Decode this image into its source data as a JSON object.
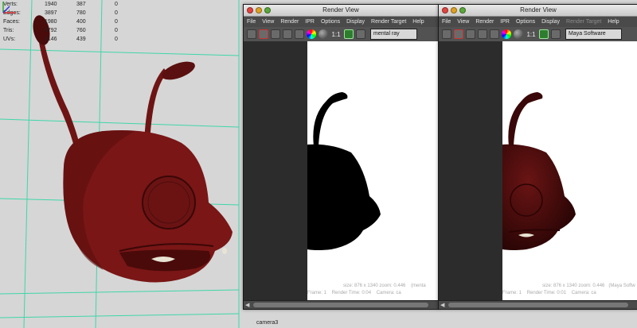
{
  "viewport": {
    "hud": [
      {
        "label": "Verts:",
        "v1": "1940",
        "v2": "387",
        "v3": "0"
      },
      {
        "label": "Edges:",
        "v1": "3897",
        "v2": "780",
        "v3": "0"
      },
      {
        "label": "Faces:",
        "v1": "1980",
        "v2": "400",
        "v3": "0"
      },
      {
        "label": "Tris:",
        "v1": "3792",
        "v2": "760",
        "v3": "0"
      },
      {
        "label": "UVs:",
        "v1": "2146",
        "v2": "439",
        "v3": "0"
      }
    ],
    "camera_label": "camera3",
    "grid_color": "#3fd6a8",
    "model_color": "#7a1616"
  },
  "render_views": [
    {
      "title": "Render View",
      "menu": [
        "File",
        "View",
        "Render",
        "IPR",
        "Options",
        "Display",
        "Render Target",
        "Help"
      ],
      "zoom": "1:1",
      "renderer": "mental ray",
      "info_line1": "size: 876 x 1340 zoom: 0.446",
      "info_line1b": "(menta",
      "info_line2": "Frame: 1",
      "info_line2b": "Render Time: 0:04",
      "info_line2c": "Camera: ca"
    },
    {
      "title": "Render View",
      "menu": [
        "File",
        "View",
        "Render",
        "IPR",
        "Options",
        "Display",
        "Render Target",
        "Help"
      ],
      "zoom": "1:1",
      "renderer": "Maya Software",
      "info_line1": "size: 876 x 1340 zoom: 0.446",
      "info_line1b": "(Maya Softw",
      "info_line2": "Frame: 1",
      "info_line2b": "Render Time: 0:01",
      "info_line2c": "Camera: ca"
    }
  ],
  "traffic_light_colors": [
    "#e0443e",
    "#dea123",
    "#5aa83a"
  ]
}
